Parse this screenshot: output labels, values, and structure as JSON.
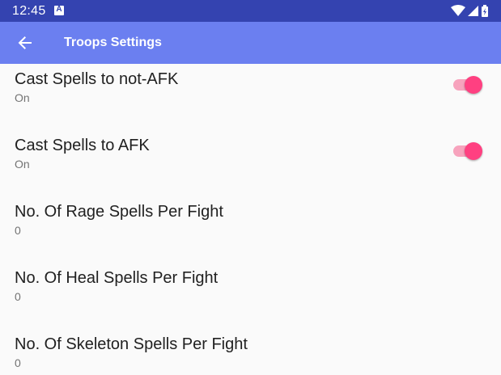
{
  "statusbar": {
    "time": "12:45",
    "notification_icon": "a-badge-icon",
    "icons": [
      "wifi-icon",
      "cell-signal-icon",
      "battery-charging-icon"
    ],
    "color": "#3443b0"
  },
  "appbar": {
    "title": "Troops Settings",
    "back_icon": "arrow-back-icon",
    "color": "#6b7ff0"
  },
  "settings": [
    {
      "title": "Cast Spells to not-AFK",
      "summary": "On",
      "switch": true
    },
    {
      "title": "Cast Spells to AFK",
      "summary": "On",
      "switch": true
    },
    {
      "title": "No. Of Rage Spells Per Fight",
      "summary": "0"
    },
    {
      "title": "No. Of Heal Spells Per Fight",
      "summary": "0"
    },
    {
      "title": "No. Of Skeleton Spells Per Fight",
      "summary": "0"
    }
  ],
  "accent_color": "#ff4081"
}
